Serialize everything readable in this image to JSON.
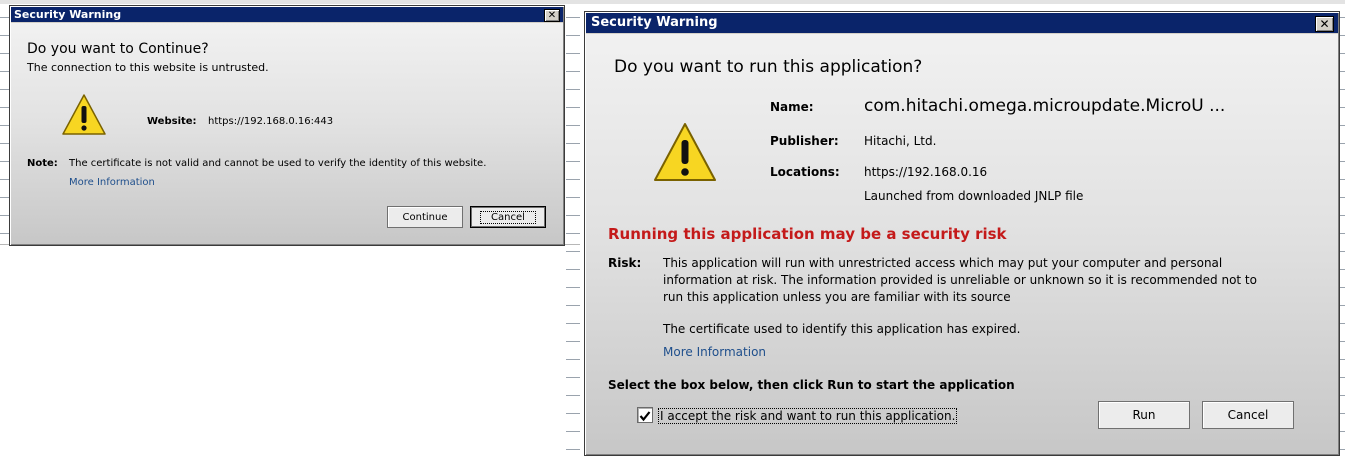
{
  "dialog1": {
    "title": "Security Warning",
    "close": "✕",
    "heading": "Do you want to Continue?",
    "subheading": "The connection to this website is untrusted.",
    "website_label": "Website:",
    "website_value": "https://192.168.0.16:443",
    "note_label": "Note:",
    "note_text": "The certificate is not valid and cannot be used to verify the identity of this website.",
    "more_info": "More Information",
    "continue_label": "Continue",
    "cancel_label": "Cancel"
  },
  "dialog2": {
    "title": "Security Warning",
    "close": "✕",
    "heading": "Do you want to run this application?",
    "name_label": "Name:",
    "name_value": "com.hitachi.omega.microupdate.MicroU ...",
    "publisher_label": "Publisher:",
    "publisher_value": "Hitachi, Ltd.",
    "locations_label": "Locations:",
    "locations_value": "https://192.168.0.16",
    "locations_note": "Launched from downloaded JNLP file",
    "risk_heading": "Running this application may be a security risk",
    "risk_label": "Risk:",
    "risk_line1": "This application will run with unrestricted access which may put your computer and personal",
    "risk_line2": "information at risk. The information provided is unreliable or unknown so it is recommended not to",
    "risk_line3": "run this application unless you are familiar with its source",
    "cert_text": "The certificate used to identify this application has expired.",
    "more_info": "More Information",
    "instruction": "Select the box below, then click Run to start the application",
    "accept_label": "I accept the risk and want to run this application.",
    "accept_checked": true,
    "run_label": "Run",
    "cancel_label": "Cancel"
  },
  "colors": {
    "titlebar": "#0a246a",
    "risk_heading": "#c41a1a",
    "link": "#1f4f8c"
  }
}
